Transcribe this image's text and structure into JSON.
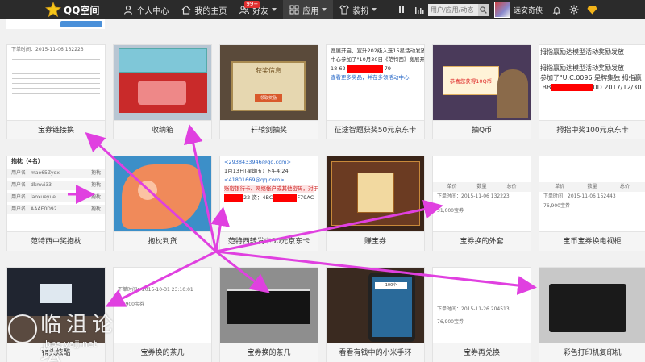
{
  "topbar": {
    "brand": "QQ空间",
    "nav": [
      {
        "label": "个人中心",
        "icon": "person-icon"
      },
      {
        "label": "我的主页",
        "icon": "home-icon"
      },
      {
        "label": "好友",
        "icon": "friends-icon",
        "badge": "99+"
      },
      {
        "label": "应用",
        "icon": "apps-icon"
      },
      {
        "label": "装扮",
        "icon": "dress-icon"
      }
    ],
    "search_placeholder": "用户/应用/动态",
    "username": "远安奇侠"
  },
  "grid": [
    {
      "caption": "宝券链接换",
      "row": 0,
      "col": 0
    },
    {
      "caption": "收纳箱",
      "row": 0,
      "col": 1
    },
    {
      "caption": "轩辕剑抽奖",
      "row": 0,
      "col": 2
    },
    {
      "caption": "征途智题获奖50元京东卡",
      "row": 0,
      "col": 3
    },
    {
      "caption": "抽Q币",
      "row": 0,
      "col": 4
    },
    {
      "caption": "拇指中奖100元京东卡",
      "row": 0,
      "col": 5
    },
    {
      "caption": "范特西中奖抱枕",
      "row": 1,
      "col": 0
    },
    {
      "caption": "抱枕到货",
      "row": 1,
      "col": 1
    },
    {
      "caption": "范特西转发中50元京东卡",
      "row": 1,
      "col": 2
    },
    {
      "caption": "赚宝券",
      "row": 1,
      "col": 3
    },
    {
      "caption": "宝券换的外套",
      "row": 1,
      "col": 4
    },
    {
      "caption": "宝币宝券换电视柜",
      "row": 1,
      "col": 5
    },
    {
      "caption": "镜头炫酷",
      "row": 2,
      "col": 0
    },
    {
      "caption": "宝券换的茶几",
      "row": 2,
      "col": 1
    },
    {
      "caption": "宝券换的茶几",
      "row": 2,
      "col": 2
    },
    {
      "caption": "看看有钱中的小米手环",
      "row": 2,
      "col": 3
    },
    {
      "caption": "宝券再兑换",
      "row": 2,
      "col": 4
    },
    {
      "caption": "彩色打印机复印机",
      "row": 2,
      "col": 5
    }
  ],
  "thumb_text": {
    "award_popup_title": "获奖信息",
    "award_popup_btn": "领取奖励",
    "qcoin_popup": "恭喜您获得10Q币",
    "hug_title": "抱枕（4名）",
    "user_label": "用户名：",
    "prize_label": "抱枕",
    "users": [
      "mao65Zyqx",
      "dkmvi33",
      "laoxueyue",
      "AAAE0D92"
    ],
    "email_line1": "<2938433946@qq.com>",
    "email_line2": "1月13日(星期五) 下午4:24",
    "email_line3": "<41801669@qq.com>",
    "email_line4": "22 资：4BC",
    "email_line5": "F79AC",
    "email_warn": "账密银行卡、网络帐户或其他密码，对于保证安全的",
    "fantasy_notice1": "宽展开启，宣升202级入选15星活动发放",
    "fantasy_notice2": "中心参加了\"10月30日《范特西》宽展开启",
    "fantasy_notice3": "18 62",
    "fantasy_notice4": "79",
    "fantasy_notice5": "查看更多奖品，并在多领活动中心",
    "order_headers": [
      "单价",
      "数量",
      "总价"
    ],
    "order_time": "下单时间：2015-11-06 132223",
    "order_price": "31,000宝券",
    "order_time2": "下单时间：2015-11-06 152443",
    "order_time3": "下单时间：2015-10-31 23:10:01",
    "order_time4": "下单时间：2015-11-26 204513",
    "coupon_value": "76,900宝券",
    "chat_popup_title": "100个",
    "right_line1": "拇指赢励达模型活动奖励发放",
    "right_line2": "拇指赢励达模型活动奖励发放",
    "right_line3": "参加了\"U.C.0096 是牌集独 拇指赢",
    ".BB_line": ".BB",
    "right_line4": "0D 2017/12/30",
    "hug_row_suffix": "抱枕"
  },
  "watermark": {
    "title": "临沮论坛",
    "url": "bbs.yajj.net"
  },
  "colors": {
    "arrow": "#e040e0",
    "topbar": "#2b2b2b",
    "redact": "#ff0000"
  }
}
